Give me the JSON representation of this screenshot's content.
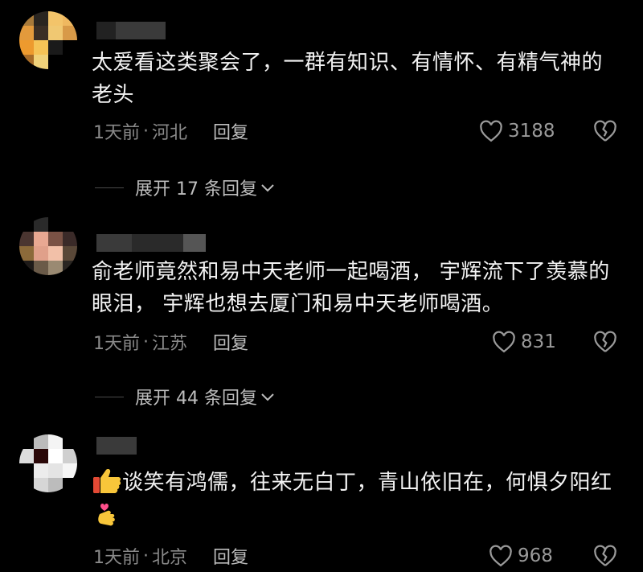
{
  "comments": [
    {
      "text": "太爱看这类聚会了，一群有知识、有情怀、有精气神的老头",
      "time": "1天前",
      "location": "河北",
      "reply_label": "回复",
      "likes": "3188",
      "expand_label": "展开 17 条回复"
    },
    {
      "text": "俞老师竟然和易中天老师一起喝酒， 宇辉流下了羡慕的眼泪， 宇辉也想去厦门和易中天老师喝酒。",
      "time": "1天前",
      "location": "江苏",
      "reply_label": "回复",
      "likes": "831",
      "expand_label": "展开 44 条回复"
    },
    {
      "text": "谈笑有鸿儒，往来无白丁，青山依旧在，何惧夕阳红",
      "time": "1天前",
      "location": "北京",
      "reply_label": "回复",
      "likes": "968"
    }
  ],
  "separator": "·",
  "colors": {
    "background": "#000000",
    "text": "#f2f2f2",
    "meta": "#8a8a8a",
    "like_icon": "#9a9a9a"
  },
  "icons": [
    "heart-icon",
    "broken-heart-icon",
    "chevron-down-icon",
    "thumbs-up-emoji",
    "heart-hands-emoji"
  ]
}
